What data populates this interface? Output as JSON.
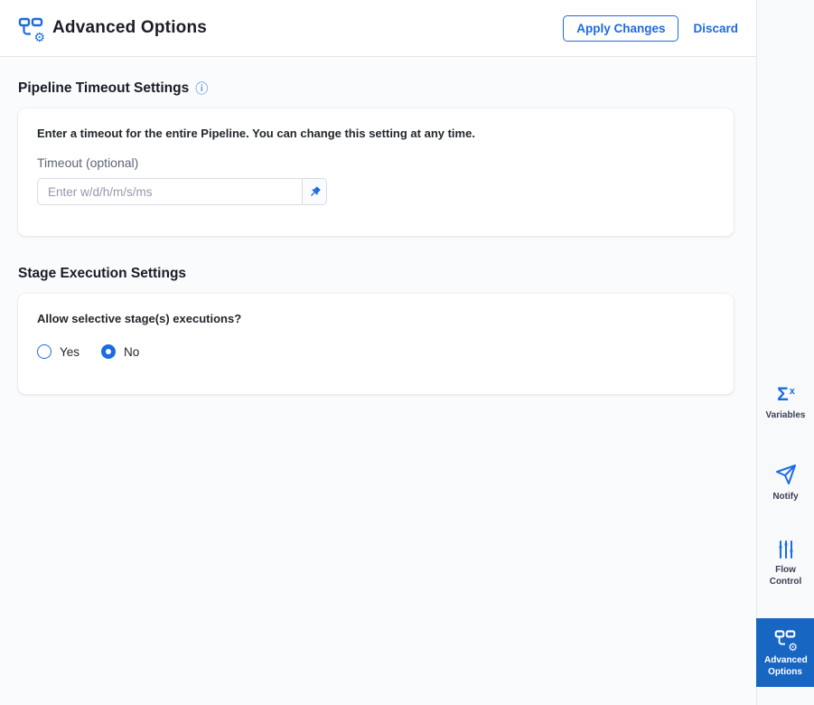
{
  "header": {
    "title": "Advanced Options",
    "apply_button": "Apply Changes",
    "discard_button": "Discard"
  },
  "pipeline_timeout": {
    "heading": "Pipeline Timeout Settings",
    "description": "Enter a timeout for the entire Pipeline. You can change this setting at any time.",
    "field_label": "Timeout (optional)",
    "input_value": "",
    "input_placeholder": "Enter w/d/h/m/s/ms"
  },
  "stage_execution": {
    "heading": "Stage Execution Settings",
    "question": "Allow selective stage(s) executions?",
    "options": [
      {
        "label": "Yes",
        "selected": false
      },
      {
        "label": "No",
        "selected": true
      }
    ]
  },
  "sidebar": {
    "items": [
      {
        "label": "Variables",
        "icon": "sigma-x-icon",
        "selected": false
      },
      {
        "label": "Notify",
        "icon": "paper-plane-icon",
        "selected": false
      },
      {
        "label": "Flow Control",
        "icon": "sliders-icon",
        "selected": false
      },
      {
        "label": "Advanced Options",
        "icon": "pipeline-gear-icon",
        "selected": true
      }
    ]
  },
  "glyphs": {
    "gear": "⚙",
    "info": "ⓘ",
    "sigma": "Σ",
    "sigma_sup": "x"
  },
  "colors": {
    "primary_blue": "#1b6ce0",
    "sidebar_selected_bg": "#1766c2",
    "content_bg": "#fafbfc",
    "sidebar_bg": "#f8f9fb",
    "text_dark": "#1c1c28",
    "label_gray": "#5e6577"
  }
}
